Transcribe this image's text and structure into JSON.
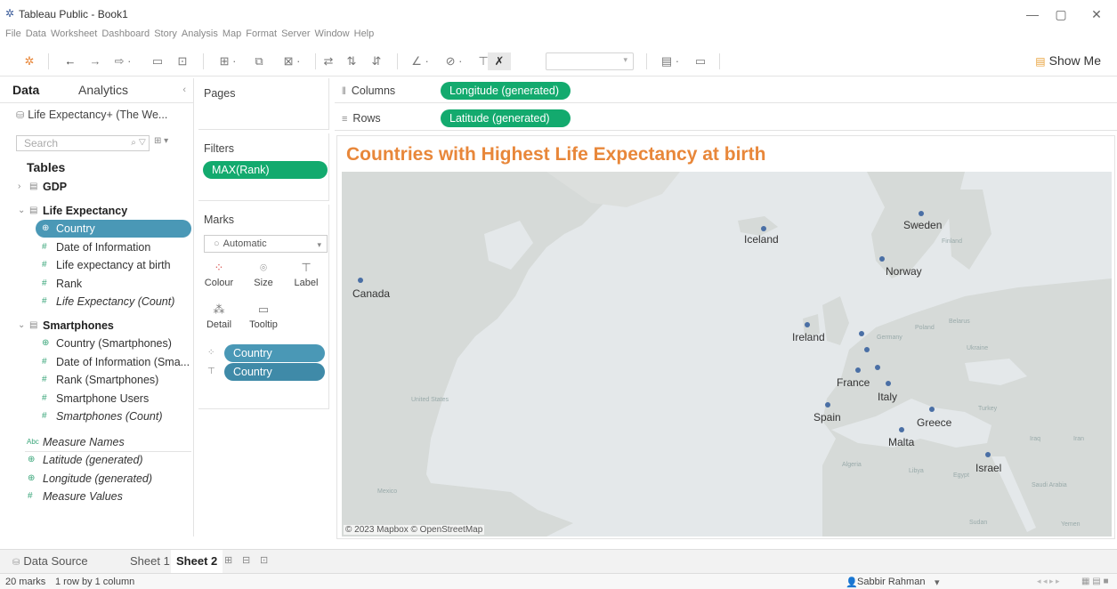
{
  "window": {
    "title": "Tableau Public - Book1",
    "minimize": "—",
    "maximize": "▢",
    "close": "✕"
  },
  "menu": [
    "File",
    "Data",
    "Worksheet",
    "Dashboard",
    "Story",
    "Analysis",
    "Map",
    "Format",
    "Server",
    "Window",
    "Help"
  ],
  "toolbar": {
    "show_me": "Show Me"
  },
  "data_pane": {
    "tab_data": "Data",
    "tab_analytics": "Analytics",
    "collapse": "‹",
    "datasource": "Life Expectancy+ (The We...",
    "search_placeholder": "Search",
    "tables_heading": "Tables",
    "tables": [
      {
        "name": "GDP",
        "expanded": false,
        "fields": []
      },
      {
        "name": "Life Expectancy",
        "expanded": true,
        "fields": [
          {
            "name": "Country",
            "type": "geo",
            "selected": true,
            "italic": false
          },
          {
            "name": "Date of Information",
            "type": "measure",
            "italic": false
          },
          {
            "name": "Life expectancy at birth",
            "type": "measure",
            "italic": false
          },
          {
            "name": "Rank",
            "type": "measure",
            "italic": false
          },
          {
            "name": "Life Expectancy (Count)",
            "type": "measure",
            "italic": true
          }
        ]
      },
      {
        "name": "Smartphones",
        "expanded": true,
        "fields": [
          {
            "name": "Country (Smartphones)",
            "type": "geo",
            "italic": false
          },
          {
            "name": "Date of Information (Sma...",
            "type": "measure",
            "italic": false
          },
          {
            "name": "Rank (Smartphones)",
            "type": "measure",
            "italic": false
          },
          {
            "name": "Smartphone Users",
            "type": "measure",
            "italic": false
          },
          {
            "name": "Smartphones (Count)",
            "type": "measure",
            "italic": true
          }
        ]
      }
    ],
    "extra_fields": [
      {
        "name": "Measure Names",
        "icon": "Abc"
      },
      {
        "name": "Latitude (generated)",
        "icon": "⊕"
      },
      {
        "name": "Longitude (generated)",
        "icon": "⊕"
      },
      {
        "name": "Measure Values",
        "icon": "#"
      }
    ]
  },
  "shelves": {
    "pages_label": "Pages",
    "filters_label": "Filters",
    "filter_pill": "MAX(Rank)",
    "marks_label": "Marks",
    "marks_type": "Automatic",
    "mark_buttons": {
      "colour": "Colour",
      "size": "Size",
      "label": "Label",
      "detail": "Detail",
      "tooltip": "Tooltip"
    },
    "mark_pills": [
      "Country",
      "Country"
    ],
    "columns_label": "Columns",
    "columns_pill": "Longitude (generated)",
    "rows_label": "Rows",
    "rows_pill": "Latitude (generated)"
  },
  "viz": {
    "title": "Countries with Highest Life Expectancy at birth",
    "attribution": "© 2023 Mapbox © OpenStreetMap",
    "countries": [
      {
        "name": "Iceland",
        "labeled": true
      },
      {
        "name": "Sweden",
        "labeled": true
      },
      {
        "name": "Norway",
        "labeled": true
      },
      {
        "name": "Canada",
        "labeled": true
      },
      {
        "name": "Ireland",
        "labeled": true
      },
      {
        "name": "France",
        "labeled": true
      },
      {
        "name": "Italy",
        "labeled": true
      },
      {
        "name": "Spain",
        "labeled": true
      },
      {
        "name": "Greece",
        "labeled": true
      },
      {
        "name": "Malta",
        "labeled": true
      },
      {
        "name": "Israel",
        "labeled": true
      }
    ],
    "base_labels": [
      "Finland",
      "Germany",
      "Poland",
      "Belarus",
      "Ukraine",
      "Turkey",
      "Iraq",
      "Iran",
      "Algeria",
      "Libya",
      "Egypt",
      "Saudi Arabia",
      "Sudan",
      "Yemen",
      "Mexico",
      "United States"
    ]
  },
  "sheet_tabs": {
    "data_source": "Data Source",
    "sheet1": "Sheet 1",
    "sheet2": "Sheet 2"
  },
  "status": {
    "marks": "20 marks",
    "layout": "1 row by 1 column",
    "user": "Sabbir Rahman"
  }
}
